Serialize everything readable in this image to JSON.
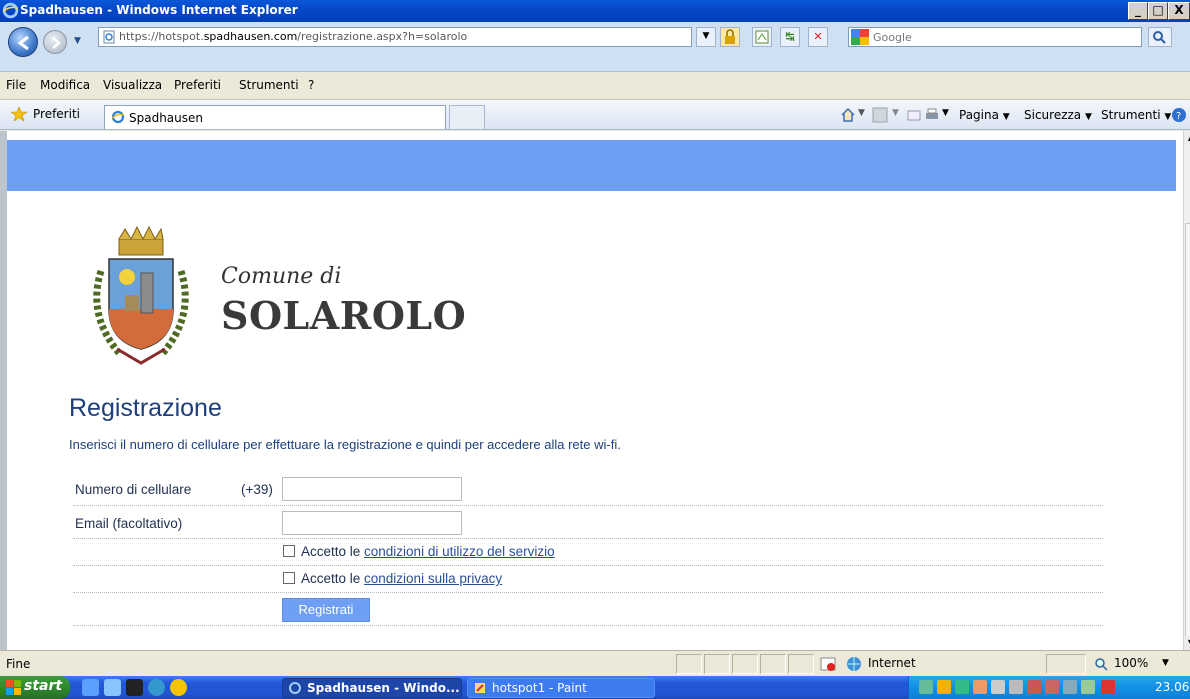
{
  "window": {
    "title": "Spadhausen - Windows Internet Explorer",
    "minimize": "_",
    "maximize": "□",
    "close": "X"
  },
  "address": {
    "url_prefix": "https://hotspot.",
    "url_host": "spadhausen.com",
    "url_path": "/registrazione.aspx?h=solarolo",
    "search_placeholder": "Google"
  },
  "menu": [
    "File",
    "Modifica",
    "Visualizza",
    "Preferiti",
    "Strumenti",
    "?"
  ],
  "favorites": {
    "label": "Preferiti",
    "tab_title": "Spadhausen",
    "commands": {
      "page": "Pagina",
      "safety": "Sicurezza",
      "tools": "Strumenti"
    }
  },
  "page": {
    "comune_di": "Comune di",
    "town": "SOLAROLO",
    "heading": "Registrazione",
    "intro": "Inserisci il numero di cellulare per effettuare la registrazione e quindi per accedere alla rete wi-fi.",
    "form": {
      "phone_label": "Numero di cellulare",
      "phone_prefix": "(+39)",
      "phone_value": "",
      "email_label": "Email (facoltativo)",
      "email_value": "",
      "terms_prefix": "Accetto le ",
      "terms_link": "condizioni di utilizzo del servizio",
      "privacy_prefix": "Accetto le ",
      "privacy_link": "condizioni sulla privacy",
      "submit": "Registrati"
    },
    "colors": {
      "banner": "#6e9ff5",
      "heading": "#1f3f7a"
    }
  },
  "status": {
    "text": "Fine",
    "zone": "Internet",
    "zoom": "100%"
  },
  "taskbar": {
    "start": "start",
    "tasks": [
      "Spadhausen - Windo...",
      "hotspot1 - Paint"
    ],
    "clock": "23.06"
  }
}
